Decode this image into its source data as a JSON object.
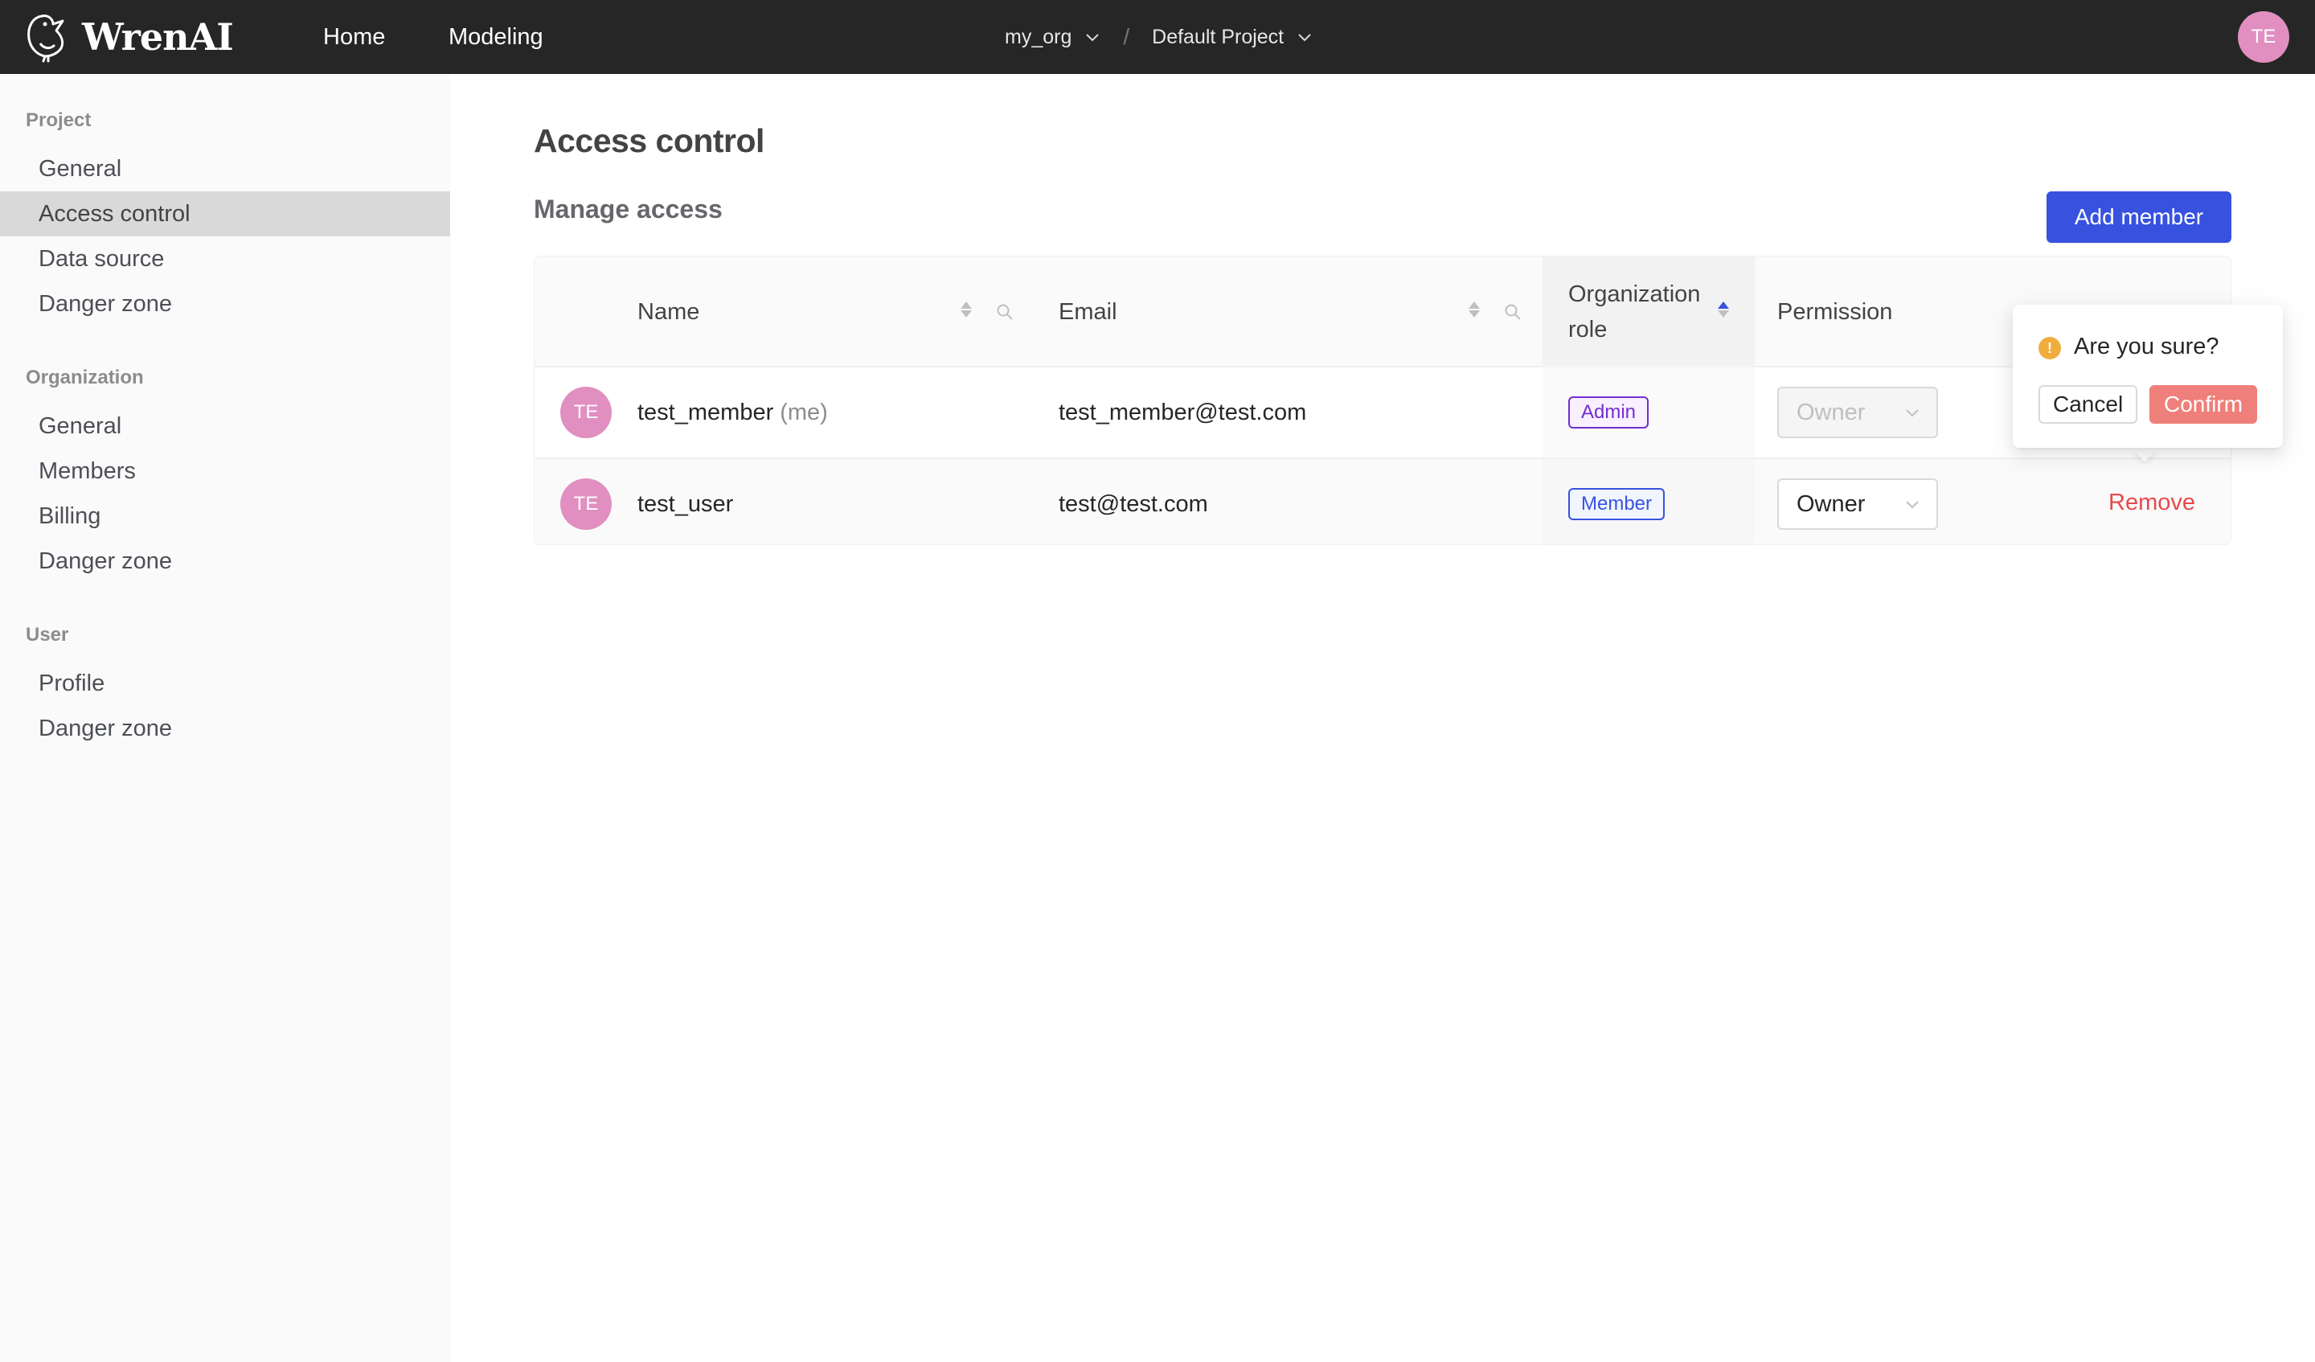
{
  "topbar": {
    "brand": "WrenAI",
    "nav": [
      {
        "label": "Home"
      },
      {
        "label": "Modeling"
      }
    ],
    "org": "my_org",
    "separator": "/",
    "project": "Default Project",
    "user_initials": "TE"
  },
  "sidebar": {
    "sections": [
      {
        "title": "Project",
        "items": [
          {
            "label": "General"
          },
          {
            "label": "Access control",
            "active": true
          },
          {
            "label": "Data source"
          },
          {
            "label": "Danger zone"
          }
        ]
      },
      {
        "title": "Organization",
        "items": [
          {
            "label": "General"
          },
          {
            "label": "Members"
          },
          {
            "label": "Billing"
          },
          {
            "label": "Danger zone"
          }
        ]
      },
      {
        "title": "User",
        "items": [
          {
            "label": "Profile"
          },
          {
            "label": "Danger zone"
          }
        ]
      }
    ]
  },
  "main": {
    "title": "Access control",
    "section_title": "Manage access",
    "add_button": "Add member",
    "table": {
      "columns": {
        "name": "Name",
        "email": "Email",
        "role_line1": "Organization",
        "role_line2": "role",
        "permission": "Permission"
      },
      "sort": {
        "column": "Organization role",
        "direction": "ascending"
      },
      "rows": [
        {
          "initials": "TE",
          "name": "test_member",
          "name_suffix": "(me)",
          "email": "test_member@test.com",
          "role": "Admin",
          "permission": "Owner",
          "permission_disabled": true,
          "action": ""
        },
        {
          "initials": "TE",
          "name": "test_user",
          "name_suffix": "",
          "email": "test@test.com",
          "role": "Member",
          "permission": "Owner",
          "permission_disabled": false,
          "action": "Remove"
        }
      ]
    },
    "popconfirm": {
      "message": "Are you sure?",
      "icon": "exclamation-circle-icon",
      "cancel": "Cancel",
      "confirm": "Confirm"
    }
  },
  "colors": {
    "topbar": "#262626",
    "primary": "#3852e0",
    "danger": "#e8494a",
    "confirm": "#ef7f7a",
    "avatar": "#e08fc0",
    "admin_tag": "#722ed1",
    "warning": "#f0ad3c"
  }
}
